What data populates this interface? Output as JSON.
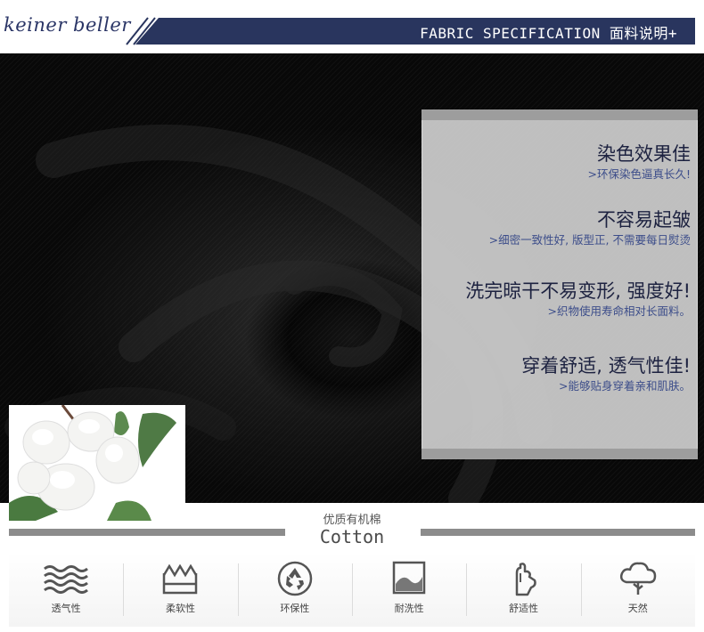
{
  "header": {
    "brand": "keiner beller",
    "title": "FABRIC SPECIFICATION 面料说明+"
  },
  "colors": {
    "navy": "#29355e",
    "feature_title": "#1d2240",
    "feature_sub": "#3c4d8a",
    "panel": "#cdcdcd",
    "rule": "#8c8c8c"
  },
  "features": [
    {
      "title": "染色效果佳",
      "sub": ">环保染色逼真长久!"
    },
    {
      "title": "不容易起皱",
      "sub": ">细密一致性好, 版型正, 不需要每日熨烫"
    },
    {
      "title": "洗完晾干不易变形, 强度好!",
      "sub": ">织物使用寿命相对长面料。"
    },
    {
      "title": "穿着舒适, 透气性佳!",
      "sub": ">能够贴身穿着亲和肌肤。"
    }
  ],
  "cotton": {
    "label_cn": "优质有机棉",
    "label_en": "Cotton"
  },
  "properties": [
    {
      "label": "透气性",
      "icon": "waves-icon"
    },
    {
      "label": "柔软性",
      "icon": "zigzag-box-icon"
    },
    {
      "label": "环保性",
      "icon": "recycle-icon"
    },
    {
      "label": "耐洗性",
      "icon": "washing-icon"
    },
    {
      "label": "舒适性",
      "icon": "hand-icon"
    },
    {
      "label": "天然",
      "icon": "tree-icon"
    }
  ]
}
